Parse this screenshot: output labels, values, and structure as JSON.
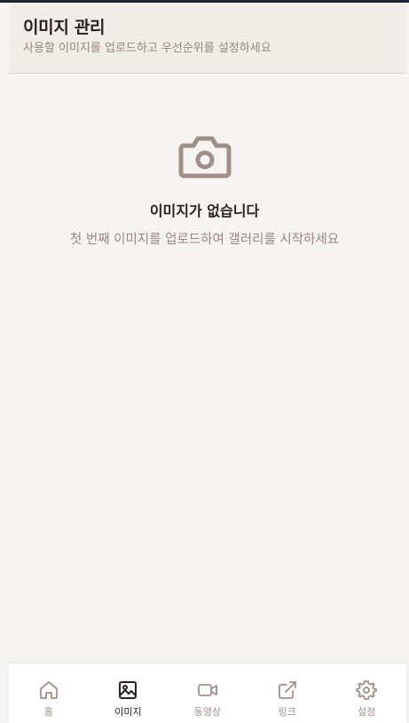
{
  "header": {
    "title": "이미지 관리",
    "subtitle": "사용할 이미지를 업로드하고 우선순위를 설정하세요"
  },
  "empty_state": {
    "icon": "camera-icon",
    "title": "이미지가 없습니다",
    "message": "첫 번째 이미지를 업로드하여 갤러리를 시작하세요"
  },
  "bottom_nav": {
    "items": [
      {
        "label": "홈",
        "icon": "home-icon",
        "active": false
      },
      {
        "label": "이미지",
        "icon": "image-icon",
        "active": true
      },
      {
        "label": "동영상",
        "icon": "video-icon",
        "active": false
      },
      {
        "label": "링크",
        "icon": "external-link-icon",
        "active": false
      },
      {
        "label": "설정",
        "icon": "gear-icon",
        "active": false
      }
    ]
  },
  "colors": {
    "background": "#f6f4f2",
    "header_bg": "#f0ece7",
    "text_dark": "#2b2020",
    "text_muted": "#9a8680",
    "icon_muted": "#a08f89"
  }
}
